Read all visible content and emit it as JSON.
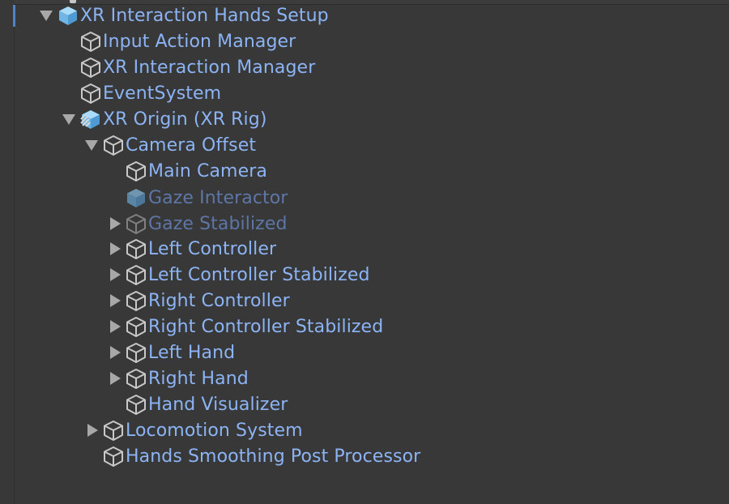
{
  "hierarchy": {
    "items": [
      {
        "label": "XR Interaction Hands Setup",
        "expander": "expanded",
        "icon": "prefab-cube-icon",
        "active": true
      },
      {
        "label": "Input Action Manager",
        "expander": "none",
        "icon": "gameobject-cube-icon",
        "active": true
      },
      {
        "label": "XR Interaction Manager",
        "expander": "none",
        "icon": "gameobject-cube-icon",
        "active": true
      },
      {
        "label": "EventSystem",
        "expander": "none",
        "icon": "gameobject-cube-icon",
        "active": true
      },
      {
        "label": "XR Origin (XR Rig)",
        "expander": "expanded",
        "icon": "prefab-variant-icon",
        "active": true
      },
      {
        "label": "Camera Offset",
        "expander": "expanded",
        "icon": "gameobject-cube-icon",
        "active": true
      },
      {
        "label": "Main Camera",
        "expander": "none",
        "icon": "gameobject-cube-icon",
        "active": true
      },
      {
        "label": "Gaze Interactor",
        "expander": "none",
        "icon": "prefab-cube-icon",
        "active": false
      },
      {
        "label": "Gaze Stabilized",
        "expander": "collapsed",
        "icon": "gameobject-cube-icon",
        "active": false
      },
      {
        "label": "Left Controller",
        "expander": "collapsed",
        "icon": "gameobject-cube-icon",
        "active": true
      },
      {
        "label": "Left Controller Stabilized",
        "expander": "collapsed",
        "icon": "gameobject-cube-icon",
        "active": true
      },
      {
        "label": "Right Controller",
        "expander": "collapsed",
        "icon": "gameobject-cube-icon",
        "active": true
      },
      {
        "label": "Right Controller Stabilized",
        "expander": "collapsed",
        "icon": "gameobject-cube-icon",
        "active": true
      },
      {
        "label": "Left Hand",
        "expander": "collapsed",
        "icon": "gameobject-cube-icon",
        "active": true
      },
      {
        "label": "Right Hand",
        "expander": "collapsed",
        "icon": "gameobject-cube-icon",
        "active": true
      },
      {
        "label": "Hand Visualizer",
        "expander": "none",
        "icon": "gameobject-cube-icon",
        "active": true
      },
      {
        "label": "Locomotion System",
        "expander": "collapsed",
        "icon": "gameobject-cube-icon",
        "active": true
      },
      {
        "label": "Hands Smoothing Post Processor",
        "expander": "none",
        "icon": "gameobject-cube-icon",
        "active": true
      }
    ]
  },
  "colors": {
    "background": "#383838",
    "label_active": "#8cb4f5",
    "label_inactive": "#5d76a6",
    "prefab_icon": "#7cc0ee",
    "scene_marker": "#4a86c5"
  }
}
